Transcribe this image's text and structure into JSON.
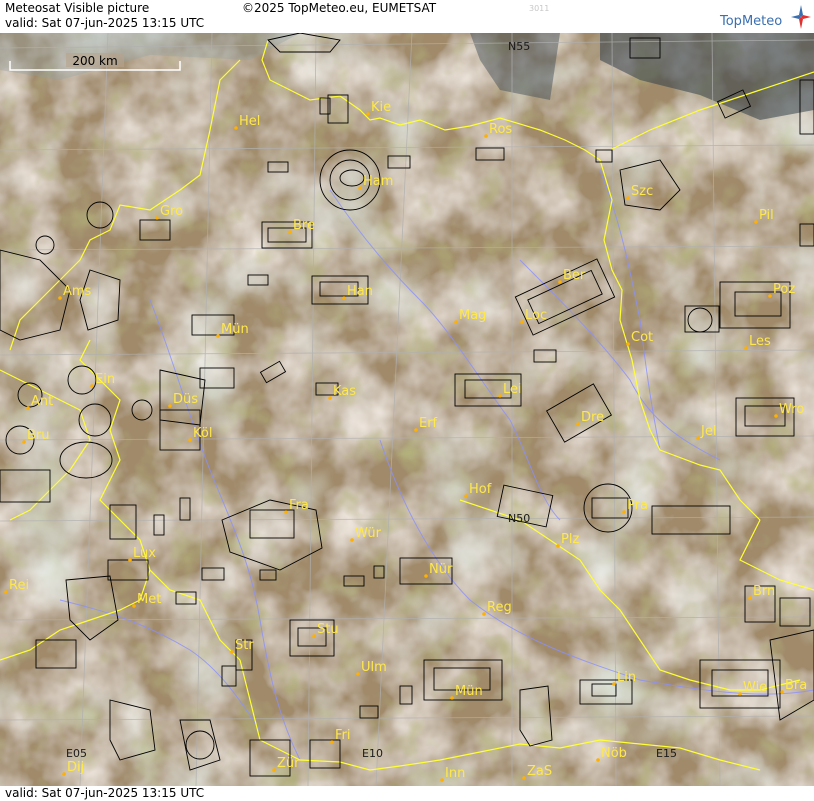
{
  "header": {
    "title": "Meteosat Visible picture",
    "copyright": "©2025 TopMeteo.eu, EUMETSAT",
    "valid": "valid:  Sat  07-jun-2025  13:15 UTC",
    "code": "3011",
    "logo_text": "TopMeteo"
  },
  "footer": {
    "valid": "valid:  Sat  07-jun-2025  13:15 UTC"
  },
  "scale": {
    "label": "200 km"
  },
  "grid_labels": [
    {
      "id": "n55",
      "text": "N55"
    },
    {
      "id": "n50",
      "text": "N50"
    },
    {
      "id": "e05",
      "text": "E05"
    },
    {
      "id": "e10",
      "text": "E10"
    },
    {
      "id": "e15",
      "text": "E15"
    }
  ],
  "cities": [
    {
      "id": "kie",
      "text": "Kie"
    },
    {
      "id": "hel",
      "text": "Hel"
    },
    {
      "id": "ros",
      "text": "Ros"
    },
    {
      "id": "ham",
      "text": "Ham"
    },
    {
      "id": "szc",
      "text": "Szc"
    },
    {
      "id": "gro",
      "text": "Gro"
    },
    {
      "id": "bre",
      "text": "Bre"
    },
    {
      "id": "pil",
      "text": "Pil"
    },
    {
      "id": "ber",
      "text": "Ber"
    },
    {
      "id": "han",
      "text": "Han"
    },
    {
      "id": "ams",
      "text": "Ams"
    },
    {
      "id": "poz",
      "text": "Poz"
    },
    {
      "id": "mag",
      "text": "Mag"
    },
    {
      "id": "loc",
      "text": "Loc"
    },
    {
      "id": "mun",
      "text": "Mün"
    },
    {
      "id": "cot",
      "text": "Cot"
    },
    {
      "id": "les",
      "text": "Les"
    },
    {
      "id": "ein",
      "text": "Ein"
    },
    {
      "id": "kas",
      "text": "Kas"
    },
    {
      "id": "lei",
      "text": "Lei"
    },
    {
      "id": "ant",
      "text": "Ant"
    },
    {
      "id": "dus",
      "text": "Düs"
    },
    {
      "id": "wro",
      "text": "Wro"
    },
    {
      "id": "dre",
      "text": "Dre"
    },
    {
      "id": "bru",
      "text": "Bru"
    },
    {
      "id": "kol",
      "text": "Köl"
    },
    {
      "id": "erf",
      "text": "Erf"
    },
    {
      "id": "jel",
      "text": "Jel"
    },
    {
      "id": "hof",
      "text": "Hof"
    },
    {
      "id": "fra",
      "text": "Fra"
    },
    {
      "id": "pra",
      "text": "Pra"
    },
    {
      "id": "wur",
      "text": "Wür"
    },
    {
      "id": "plz",
      "text": "Plz"
    },
    {
      "id": "lux",
      "text": "Lux"
    },
    {
      "id": "nur",
      "text": "Nür"
    },
    {
      "id": "rei",
      "text": "Rei"
    },
    {
      "id": "brn",
      "text": "Brn"
    },
    {
      "id": "met",
      "text": "Met"
    },
    {
      "id": "reg",
      "text": "Reg"
    },
    {
      "id": "stu",
      "text": "Stu"
    },
    {
      "id": "str",
      "text": "Str"
    },
    {
      "id": "ulm",
      "text": "Ulm"
    },
    {
      "id": "lin",
      "text": "Lin"
    },
    {
      "id": "mue",
      "text": "Mün"
    },
    {
      "id": "wie",
      "text": "Wie"
    },
    {
      "id": "bra",
      "text": "Bra"
    },
    {
      "id": "fri",
      "text": "Fri"
    },
    {
      "id": "dij",
      "text": "Dij"
    },
    {
      "id": "zur",
      "text": "Zür"
    },
    {
      "id": "inn",
      "text": "Inn"
    },
    {
      "id": "zas",
      "text": "ZaS"
    },
    {
      "id": "nob",
      "text": "Nöb"
    }
  ],
  "colors": {
    "label": "#ffe84a",
    "city_dot": "#ffb000",
    "border": "#ffff33",
    "river": "#8a90ff",
    "grid": "#aaaaaa",
    "airspace": "#000000"
  }
}
